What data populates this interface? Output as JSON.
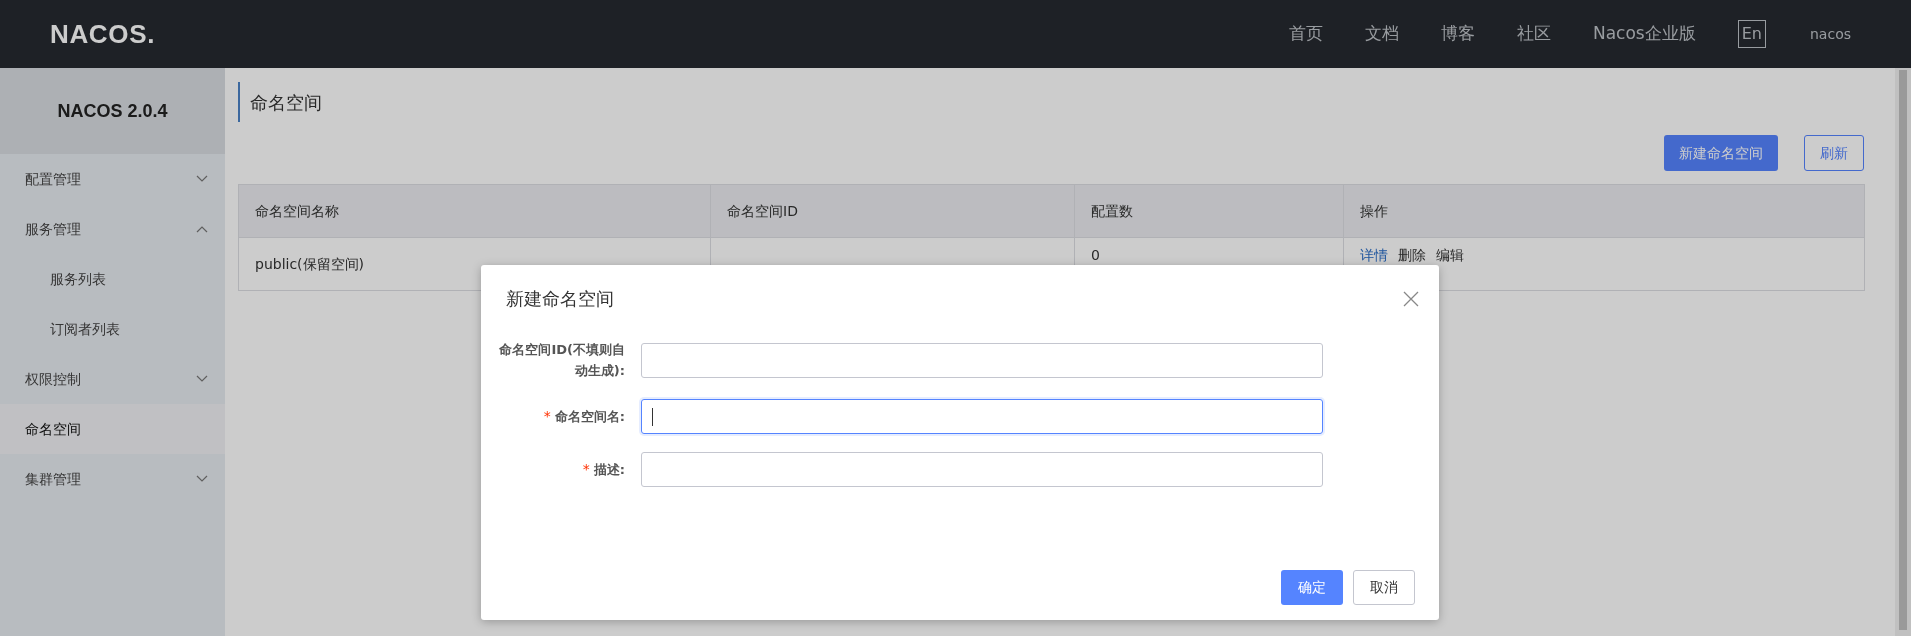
{
  "header": {
    "logo": "NACOS.",
    "nav": [
      "首页",
      "文档",
      "博客",
      "社区",
      "Nacos企业版"
    ],
    "language": "En",
    "user": "nacos"
  },
  "sidebar": {
    "title": "NACOS 2.0.4",
    "items": [
      {
        "label": "配置管理",
        "expanded": false,
        "selected": false
      },
      {
        "label": "服务管理",
        "expanded": true,
        "selected": false,
        "children": [
          {
            "label": "服务列表",
            "selected": false
          },
          {
            "label": "订阅者列表",
            "selected": false
          }
        ]
      },
      {
        "label": "权限控制",
        "expanded": false,
        "selected": false
      },
      {
        "label": "命名空间",
        "expanded": false,
        "selected": true
      },
      {
        "label": "集群管理",
        "expanded": false,
        "selected": false
      }
    ]
  },
  "page": {
    "title": "命名空间",
    "buttons": [
      {
        "label": "新建命名空间",
        "kind": "primary"
      },
      {
        "label": "刷新",
        "kind": "outline"
      }
    ]
  },
  "table": {
    "columns": [
      "命名空间名称",
      "命名空间ID",
      "配置数",
      "操作"
    ],
    "rows": [
      {
        "name": "public(保留空间)",
        "count": "0",
        "actions": [
          {
            "label": "详情",
            "kind": "link"
          },
          {
            "label": "删除",
            "kind": "text"
          },
          {
            "label": "编辑",
            "kind": "text"
          }
        ]
      }
    ]
  },
  "dialog": {
    "title": "新建命名空间",
    "fields": [
      {
        "label": "命名空间ID(不填则自动生成):",
        "focused": false
      },
      {
        "label": "命名空间名:",
        "required_mark": "*",
        "focused": true
      },
      {
        "label": "描述:",
        "required_mark": "*",
        "focused": false
      }
    ],
    "buttons": [
      {
        "label": "确定",
        "kind": "primary"
      },
      {
        "label": "取消",
        "kind": "secondary"
      }
    ]
  }
}
